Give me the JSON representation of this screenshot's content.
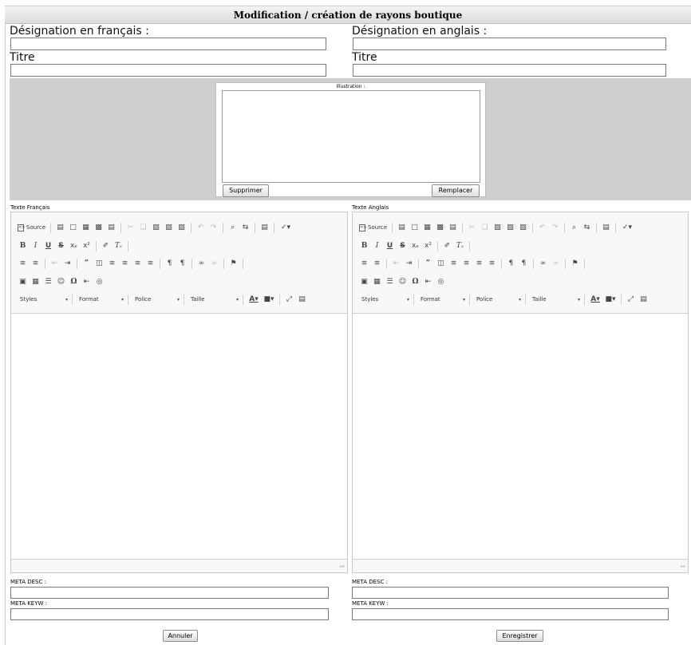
{
  "title": "Modification / création de rayons boutique",
  "fields": {
    "designation_fr_label": "Désignation en français :",
    "designation_fr_value": "",
    "designation_en_label": "Désignation en anglais :",
    "designation_en_value": "",
    "titre_fr_label": "Titre",
    "titre_fr_value": "",
    "titre_en_label": "Titre",
    "titre_en_value": ""
  },
  "illustration": {
    "label": "Illustration :",
    "delete_label": "Supprimer",
    "replace_label": "Remplacer"
  },
  "editors": {
    "fr_label": "Texte Français",
    "en_label": "Texte Anglais",
    "source_label": "Source",
    "styles_label": "Styles",
    "format_label": "Format",
    "police_label": "Police",
    "taille_label": "Taille",
    "fr_content": "",
    "en_content": ""
  },
  "meta": {
    "desc_label": "META DESC :",
    "keyw_label": "META KEYW :",
    "fr_desc_value": "",
    "fr_keyw_value": "",
    "en_desc_value": "",
    "en_keyw_value": ""
  },
  "actions": {
    "cancel_label": "Annuler",
    "save_label": "Enregistrer"
  },
  "icons": {
    "source": "source-icon",
    "save": "save-icon",
    "new_page": "new-page-icon",
    "preview": "preview-icon",
    "print": "print-icon",
    "templates": "templates-icon",
    "cut": "cut-icon",
    "copy": "copy-icon",
    "paste": "paste-icon",
    "paste_text": "paste-text-icon",
    "paste_word": "paste-word-icon",
    "undo": "undo-icon",
    "redo": "redo-icon",
    "find": "find-icon",
    "replace": "replace-icon",
    "select_all": "select-all-icon",
    "spellcheck": "spellcheck-icon",
    "bold": "bold-icon",
    "italic": "italic-icon",
    "underline": "underline-icon",
    "strike": "strikethrough-icon",
    "subscript": "subscript-icon",
    "superscript": "superscript-icon",
    "copy_format": "copy-format-icon",
    "remove_format": "remove-format-icon",
    "numbered_list": "numbered-list-icon",
    "bullet_list": "bulleted-list-icon",
    "outdent": "outdent-icon",
    "indent": "indent-icon",
    "blockquote": "blockquote-icon",
    "div": "create-div-icon",
    "align_left": "align-left-icon",
    "align_center": "align-center-icon",
    "align_right": "align-right-icon",
    "justify": "justify-icon",
    "ltr": "text-direction-ltr-icon",
    "rtl": "text-direction-rtl-icon",
    "link": "link-icon",
    "unlink": "unlink-icon",
    "anchor": "anchor-icon",
    "image": "image-icon",
    "table": "table-icon",
    "hr": "horizontal-line-icon",
    "smiley": "smiley-icon",
    "special_char": "special-character-icon",
    "page_break": "page-break-icon",
    "iframe": "iframe-icon",
    "text_color": "text-color-icon",
    "bg_color": "background-color-icon",
    "maximize": "maximize-icon",
    "show_blocks": "show-blocks-icon",
    "resize": "resize-grip-icon"
  }
}
